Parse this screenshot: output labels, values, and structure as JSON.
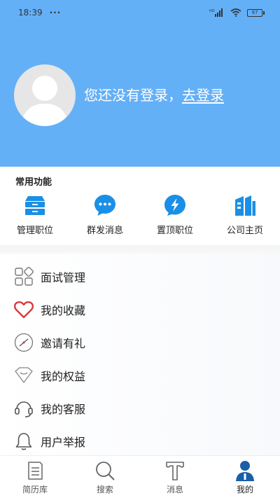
{
  "status_bar": {
    "time": "18:39",
    "dots": "···",
    "battery": "97"
  },
  "header": {
    "bg_color": "#64b0f7",
    "login_prompt": "您还没有登录，",
    "login_link": "去登录"
  },
  "quick_functions": {
    "title": "常用功能",
    "icon_color": "#1a8fe6",
    "items": [
      {
        "label": "管理职位",
        "icon": "drawer-icon"
      },
      {
        "label": "群发消息",
        "icon": "chat-bubble-icon"
      },
      {
        "label": "置顶职位",
        "icon": "lightning-icon"
      },
      {
        "label": "公司主页",
        "icon": "building-icon"
      }
    ]
  },
  "menu": [
    {
      "label": "面试管理",
      "icon": "grid-icon"
    },
    {
      "label": "我的收藏",
      "icon": "heart-icon"
    },
    {
      "label": "邀请有礼",
      "icon": "gift-icon"
    },
    {
      "label": "我的权益",
      "icon": "diamond-icon"
    },
    {
      "label": "我的客服",
      "icon": "headset-icon"
    },
    {
      "label": "用户举报",
      "icon": "bell-icon"
    }
  ],
  "bottom_nav": [
    {
      "label": "简历库",
      "icon": "document-icon"
    },
    {
      "label": "搜索",
      "icon": "search-icon"
    },
    {
      "label": "消息",
      "icon": "message-icon"
    },
    {
      "label": "我的",
      "icon": "profile-icon",
      "active": true
    }
  ],
  "colors": {
    "accent": "#1a8fe6",
    "active_nav": "#1a5fa8",
    "heart": "#d93a3a"
  }
}
